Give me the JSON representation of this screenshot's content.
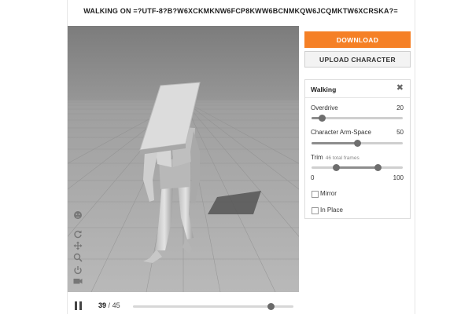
{
  "header": {
    "title": "WALKING ON =?UTF-8?B?W6XCKMKNW6FCP8KWW6BCNMKQW6JCQMKTW6XCRSKA?="
  },
  "actions": {
    "download_label": "DOWNLOAD",
    "upload_label": "UPLOAD CHARACTER",
    "accent_color": "#f58026"
  },
  "panel": {
    "title": "Walking",
    "close_icon": "close-icon",
    "overdrive": {
      "label": "Overdrive",
      "value": "20",
      "level": 0.12
    },
    "arm_space": {
      "label": "Character Arm-Space",
      "value": "50",
      "level": 0.5
    },
    "trim": {
      "label": "Trim",
      "sublabel": "46 total frames",
      "start": "0",
      "end": "100",
      "range_low": 0.27,
      "range_high": 0.73
    },
    "mirror_label": "Mirror",
    "in_place_label": "In Place"
  },
  "playback": {
    "current_frame": "39",
    "separator": "/",
    "total_frames": "45",
    "progress": 0.86
  },
  "viewport_tools": [
    "character-icon",
    "rotate-icon",
    "pan-icon",
    "zoom-icon",
    "reset-icon",
    "camera-icon"
  ]
}
